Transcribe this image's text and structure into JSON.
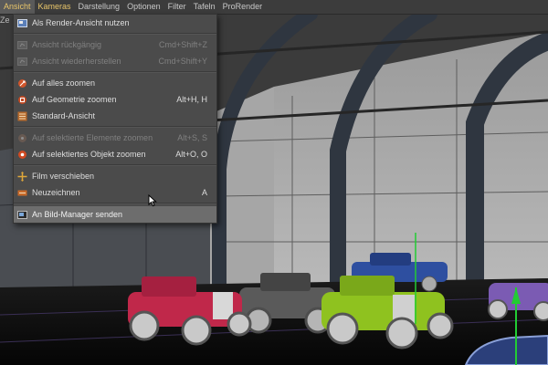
{
  "menubar": {
    "items": [
      {
        "label": "Ansicht"
      },
      {
        "label": "Kameras"
      },
      {
        "label": "Darstellung"
      },
      {
        "label": "Optionen"
      },
      {
        "label": "Filter"
      },
      {
        "label": "Tafeln"
      },
      {
        "label": "ProRender"
      }
    ]
  },
  "viewport": {
    "label": "Ze"
  },
  "dropdown": {
    "groups": [
      [
        {
          "label": "Als Render-Ansicht nutzen",
          "shortcut": "",
          "icon": "render-view-icon",
          "enabled": true
        }
      ],
      [
        {
          "label": "Ansicht rückgängig",
          "shortcut": "Cmd+Shift+Z",
          "icon": "undo-view-icon",
          "enabled": false
        },
        {
          "label": "Ansicht wiederherstellen",
          "shortcut": "Cmd+Shift+Y",
          "icon": "redo-view-icon",
          "enabled": false
        }
      ],
      [
        {
          "label": "Auf alles zoomen",
          "shortcut": "",
          "icon": "zoom-all-icon",
          "enabled": true
        },
        {
          "label": "Auf Geometrie zoomen",
          "shortcut": "Alt+H, H",
          "icon": "zoom-geometry-icon",
          "enabled": true
        },
        {
          "label": "Standard-Ansicht",
          "shortcut": "",
          "icon": "default-view-icon",
          "enabled": true
        }
      ],
      [
        {
          "label": "Auf selektierte Elemente zoomen",
          "shortcut": "Alt+S, S",
          "icon": "zoom-selected-elements-icon",
          "enabled": false
        },
        {
          "label": "Auf selektiertes Objekt zoomen",
          "shortcut": "Alt+O, O",
          "icon": "zoom-selected-object-icon",
          "enabled": true
        }
      ],
      [
        {
          "label": "Film verschieben",
          "shortcut": "",
          "icon": "film-move-icon",
          "enabled": true
        },
        {
          "label": "Neuzeichnen",
          "shortcut": "A",
          "icon": "redraw-icon",
          "enabled": true
        }
      ],
      [
        {
          "label": "An Bild-Manager senden",
          "shortcut": "",
          "icon": "picture-viewer-icon",
          "enabled": true,
          "selected": true
        }
      ]
    ]
  },
  "colors": {
    "accent": "#e8c56a",
    "menu_bg": "#4b4b4b",
    "menubar_bg": "#3c3c3c",
    "car_red": "#c0284a",
    "car_gray": "#5a5a5a",
    "car_green": "#8fc21f",
    "car_blue": "#2e4fa0",
    "car_purple": "#7b5bb3",
    "axis_green": "#22cc33"
  }
}
